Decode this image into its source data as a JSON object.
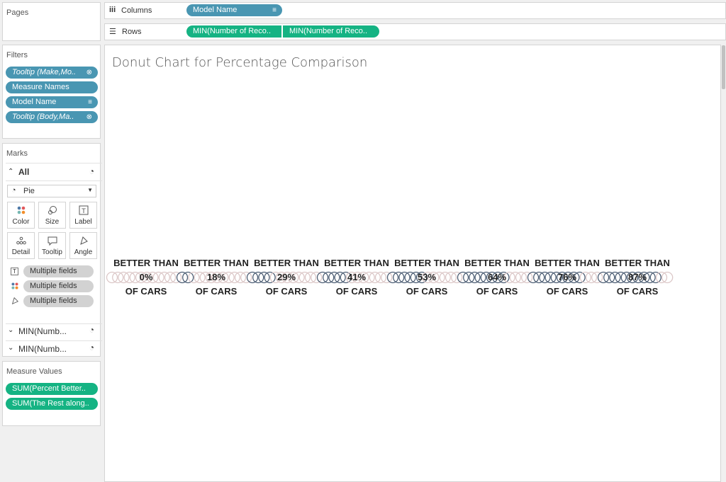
{
  "pages": {
    "title": "Pages"
  },
  "columns_shelf": {
    "label": "Columns",
    "pills": [
      {
        "text": "Model Name"
      }
    ]
  },
  "rows_shelf": {
    "label": "Rows",
    "pills": [
      {
        "text": "MIN(Number of Reco.."
      },
      {
        "text": "MIN(Number of Reco.."
      }
    ]
  },
  "filters": {
    "title": "Filters",
    "items": [
      {
        "text": "Tooltip (Make,Mo.."
      },
      {
        "text": "Measure Names"
      },
      {
        "text": "Model Name"
      },
      {
        "text": "Tooltip (Body,Ma.."
      }
    ]
  },
  "marks": {
    "title": "Marks",
    "all_label": "All",
    "mark_type": "Pie",
    "buttons": [
      {
        "label": "Color",
        "icon": "color-dots-icon"
      },
      {
        "label": "Size",
        "icon": "size-icon"
      },
      {
        "label": "Label",
        "icon": "label-icon"
      },
      {
        "label": "Detail",
        "icon": "detail-icon"
      },
      {
        "label": "Tooltip",
        "icon": "tooltip-icon"
      },
      {
        "label": "Angle",
        "icon": "angle-icon"
      }
    ],
    "encodings": [
      {
        "text": "Multiple fields",
        "icon": "label-icon"
      },
      {
        "text": "Multiple fields",
        "icon": "color-dots-icon"
      },
      {
        "text": "Multiple fields",
        "icon": "angle-icon"
      }
    ],
    "sub_marks": [
      {
        "text": "MIN(Numb..."
      },
      {
        "text": "MIN(Numb..."
      }
    ]
  },
  "measure_values": {
    "title": "Measure Values",
    "items": [
      {
        "text": "SUM(Percent Better.."
      },
      {
        "text": "SUM(The Rest along.."
      }
    ]
  },
  "chart": {
    "title": "Donut Chart for Percentage Comparison"
  },
  "chart_data": {
    "type": "pie",
    "title": "Donut Chart for Percentage Comparison",
    "label_top": "BETTER THAN",
    "label_bottom": "OF CARS",
    "categories": [
      "0%",
      "18%",
      "29%",
      "41%",
      "53%",
      "64%",
      "76%",
      "87%"
    ],
    "values": [
      0,
      18,
      29,
      41,
      53,
      64,
      76,
      87
    ],
    "colors": {
      "better": "#4e5f75",
      "rest": "#dcc8c8"
    }
  }
}
